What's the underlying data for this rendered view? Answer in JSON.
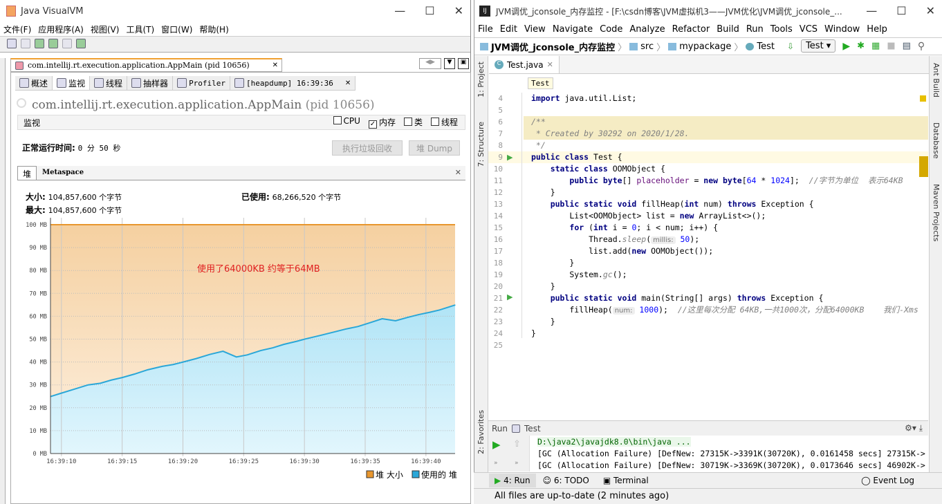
{
  "visualvm": {
    "title": "Java VisualVM",
    "menu": [
      "文件(F)",
      "应用程序(A)",
      "视图(V)",
      "工具(T)",
      "窗口(W)",
      "帮助(H)"
    ],
    "doc_tab": "com.intellij.rt.execution.application.AppMain (pid 10656)",
    "subtabs": [
      "概述",
      "监视",
      "线程",
      "抽样器",
      "Profiler",
      "[heapdump] 16:39:36"
    ],
    "app_title": "com.intellij.rt.execution.application.AppMain",
    "app_pid": "(pid 10656)",
    "section": "监视",
    "checks": [
      {
        "label": "CPU",
        "checked": false
      },
      {
        "label": "内存",
        "checked": true
      },
      {
        "label": "类",
        "checked": false
      },
      {
        "label": "线程",
        "checked": false
      }
    ],
    "uptime_label": "正常运行时间:",
    "uptime_value": "0 分 50 秒",
    "gc_button": "执行垃圾回收",
    "dump_button": "堆 Dump",
    "mem_tabs": [
      "堆",
      "Metaspace"
    ],
    "size_label": "大小:",
    "size_value": "104,857,600 个字节",
    "max_label": "最大:",
    "max_value": "104,857,600 个字节",
    "used_label": "已使用:",
    "used_value": "68,266,520 个字节",
    "annotation": "使用了64000KB  约等于64MB"
  },
  "chart_data": {
    "type": "area",
    "y_ticks": [
      "0 MB",
      "10 MB",
      "20 MB",
      "30 MB",
      "40 MB",
      "50 MB",
      "60 MB",
      "70 MB",
      "80 MB",
      "90 MB",
      "100 MB"
    ],
    "x_ticks": [
      "16:39:10",
      "16:39:15",
      "16:39:20",
      "16:39:25",
      "16:39:30",
      "16:39:35",
      "16:39:40"
    ],
    "ylim": [
      0,
      100
    ],
    "xlim": [
      "16:39:09.1",
      "16:39:42.4"
    ],
    "grid": true,
    "legend": "bottom-right",
    "series": [
      {
        "name": "堆 大小",
        "color": "#e8962e",
        "x": [
          "16:39:09.1",
          "16:39:42.4"
        ],
        "y": [
          100,
          100
        ]
      },
      {
        "name": "使用的 堆",
        "color": "#2aa7d8",
        "x": [
          "16:39:09.1",
          "16:39:10.0",
          "16:39:11.1",
          "16:39:12.2",
          "16:39:13.2",
          "16:39:14.1",
          "16:39:15.0",
          "16:39:16.0",
          "16:39:17.1",
          "16:39:18.3",
          "16:39:19.2",
          "16:39:20.1",
          "16:39:21.1",
          "16:39:22.2",
          "16:39:23.3",
          "16:39:24.4",
          "16:39:25.3",
          "16:39:26.4",
          "16:39:27.4",
          "16:39:28.3",
          "16:39:29.4",
          "16:39:30.1",
          "16:39:31.3",
          "16:39:32.5",
          "16:39:33.4",
          "16:39:34.4",
          "16:39:35.3",
          "16:39:36.4",
          "16:39:37.5",
          "16:39:38.5",
          "16:39:39.4",
          "16:39:40.3",
          "16:39:41.1",
          "16:39:42.4"
        ],
        "y": [
          24.9,
          26.4,
          28.2,
          30.0,
          30.7,
          32.1,
          33.2,
          34.7,
          36.6,
          38.1,
          38.9,
          40.1,
          41.5,
          43.3,
          44.7,
          42.2,
          43.1,
          45.0,
          46.2,
          47.7,
          49.1,
          50.1,
          51.6,
          53.2,
          54.4,
          55.5,
          57.0,
          58.9,
          58.0,
          59.5,
          60.7,
          61.7,
          62.7,
          64.9
        ]
      }
    ]
  },
  "idea": {
    "title": "JVM调优_jconsole_内存监控 - [F:\\csdn博客\\JVM虚拟机3——JVM优化\\JVM调优_jconsole_...",
    "menu": [
      "File",
      "Edit",
      "View",
      "Navigate",
      "Code",
      "Analyze",
      "Refactor",
      "Build",
      "Run",
      "Tools",
      "VCS",
      "Window",
      "Help"
    ],
    "breadcrumb": [
      "JVM调优_jconsole_内存监控",
      "src",
      "mypackage",
      "Test"
    ],
    "run_config": "Test",
    "file_tab": "Test.java",
    "tooltip": "Test",
    "left_tools": [
      "1: Project",
      "7: Structure",
      "2: Favorites"
    ],
    "right_tools": [
      "Ant Build",
      "Database",
      "Maven Projects"
    ],
    "lines": [
      {
        "n": "4",
        "t": [
          [
            "kw",
            "import"
          ],
          [
            "pl",
            " java.util.List;"
          ]
        ]
      },
      {
        "n": "5",
        "t": []
      },
      {
        "n": "6",
        "t": [
          [
            "cm",
            "/**"
          ]
        ]
      },
      {
        "n": "7",
        "t": [
          [
            "cm",
            " * Created by 30292 on 2020/1/28."
          ]
        ]
      },
      {
        "n": "8",
        "t": [
          [
            "cm",
            " */"
          ]
        ]
      },
      {
        "n": "9",
        "t": [
          [
            "kw",
            "public class"
          ],
          [
            "pl",
            " Test {"
          ]
        ]
      },
      {
        "n": "10",
        "t": [
          [
            "pl",
            "    "
          ],
          [
            "kw",
            "static class"
          ],
          [
            "pl",
            " OOMObject {"
          ]
        ]
      },
      {
        "n": "11",
        "t": [
          [
            "pl",
            "        "
          ],
          [
            "kw",
            "public byte"
          ],
          [
            "pl",
            "[] "
          ],
          [
            "fld",
            "placeholder"
          ],
          [
            "pl",
            " = "
          ],
          [
            "kw",
            "new byte"
          ],
          [
            "pl",
            "["
          ],
          [
            "num",
            "64"
          ],
          [
            "pl",
            " * "
          ],
          [
            "num",
            "1024"
          ],
          [
            "pl",
            "];  "
          ],
          [
            "cm",
            "//字节为单位  表示64KB"
          ]
        ]
      },
      {
        "n": "12",
        "t": [
          [
            "pl",
            "    }"
          ]
        ]
      },
      {
        "n": "13",
        "t": [
          [
            "pl",
            "    "
          ],
          [
            "kw",
            "public static void"
          ],
          [
            "pl",
            " fillHeap("
          ],
          [
            "kw",
            "int"
          ],
          [
            "pl",
            " num) "
          ],
          [
            "kw",
            "throws"
          ],
          [
            "pl",
            " Exception {"
          ]
        ]
      },
      {
        "n": "14",
        "t": [
          [
            "pl",
            "        List<OOMObject> list = "
          ],
          [
            "kw",
            "new"
          ],
          [
            "pl",
            " ArrayList<>();"
          ]
        ]
      },
      {
        "n": "15",
        "t": [
          [
            "pl",
            "        "
          ],
          [
            "kw",
            "for"
          ],
          [
            "pl",
            " ("
          ],
          [
            "kw",
            "int"
          ],
          [
            "pl",
            " i = "
          ],
          [
            "num",
            "0"
          ],
          [
            "pl",
            "; i < num; i++) {"
          ]
        ]
      },
      {
        "n": "16",
        "t": [
          [
            "pl",
            "            Thread."
          ],
          [
            "cm",
            "sleep"
          ],
          [
            "pl",
            "("
          ],
          [
            "hint",
            "millis:"
          ],
          [
            "num",
            " 50"
          ],
          [
            "pl",
            ");"
          ]
        ]
      },
      {
        "n": "17",
        "t": [
          [
            "pl",
            "            list.add("
          ],
          [
            "kw",
            "new"
          ],
          [
            "pl",
            " OOMObject());"
          ]
        ]
      },
      {
        "n": "18",
        "t": [
          [
            "pl",
            "        }"
          ]
        ]
      },
      {
        "n": "19",
        "t": [
          [
            "pl",
            "        System."
          ],
          [
            "cm",
            "gc"
          ],
          [
            "pl",
            "();"
          ]
        ]
      },
      {
        "n": "20",
        "t": [
          [
            "pl",
            "    }"
          ]
        ]
      },
      {
        "n": "21",
        "t": [
          [
            "pl",
            "    "
          ],
          [
            "kw",
            "public static void"
          ],
          [
            "pl",
            " main(String[] args) "
          ],
          [
            "kw",
            "throws"
          ],
          [
            "pl",
            " Exception {"
          ]
        ]
      },
      {
        "n": "22",
        "t": [
          [
            "pl",
            "        fillHeap("
          ],
          [
            "hint",
            "num:"
          ],
          [
            "num",
            " 1000"
          ],
          [
            "pl",
            ");  "
          ],
          [
            "cm",
            "//这里每次分配 64KB,一共1000次，分配64000KB    我们-Xms"
          ]
        ]
      },
      {
        "n": "23",
        "t": [
          [
            "pl",
            "    }"
          ]
        ]
      },
      {
        "n": "24",
        "t": [
          [
            "pl",
            "}"
          ]
        ]
      },
      {
        "n": "25",
        "t": []
      }
    ],
    "run_label": "Run",
    "run_tab": "Test",
    "console": [
      "D:\\java2\\javajdk8.0\\bin\\java ...",
      "[GC (Allocation Failure) [DefNew: 27315K->3391K(30720K), 0.0161458 secs] 27315K->",
      "[GC (Allocation Failure) [DefNew: 30719K->3369K(30720K), 0.0173646 secs] 46902K->"
    ],
    "bottom_tabs": [
      "4: Run",
      "6: TODO",
      "Terminal"
    ],
    "event_log": "Event Log",
    "status": "All files are up-to-date (2 minutes ago)"
  }
}
